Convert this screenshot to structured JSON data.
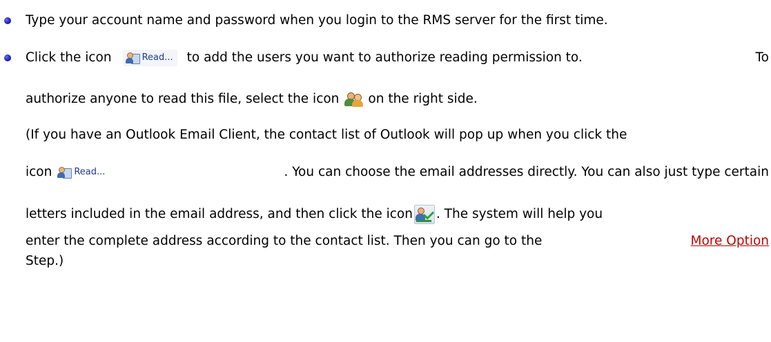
{
  "bullets": [
    {
      "text": "Type your account name and password when you login to the RMS server for the first time."
    },
    {
      "line1_a": "Click the icon",
      "read_label": "Read...",
      "line1_b": "to add the users you want to authorize reading permission to.",
      "line1_c": "To",
      "line2_a": "authorize anyone to read this file, select the icon",
      "line2_b": "on the right side.",
      "line3": "(If you have an Outlook Email Client, the contact list of Outlook will pop up when you click the",
      "line4_a": "icon",
      "line4_b": ". You can choose the email addresses directly. You can also just type certain",
      "line5_a": "letters included in the email address, and then click the icon",
      "line5_b": ". The system will help you",
      "line6_a": "enter the complete address according to the contact list. Then you can go to the",
      "line6_link": "More Option",
      "line7": "Step.)"
    }
  ],
  "icons": {
    "read_button": "read-button-icon",
    "users": "group-users-icon",
    "check_names": "check-names-icon"
  },
  "colors": {
    "link": "#c00000",
    "bullet": "#1f24b8",
    "text": "#000000"
  }
}
